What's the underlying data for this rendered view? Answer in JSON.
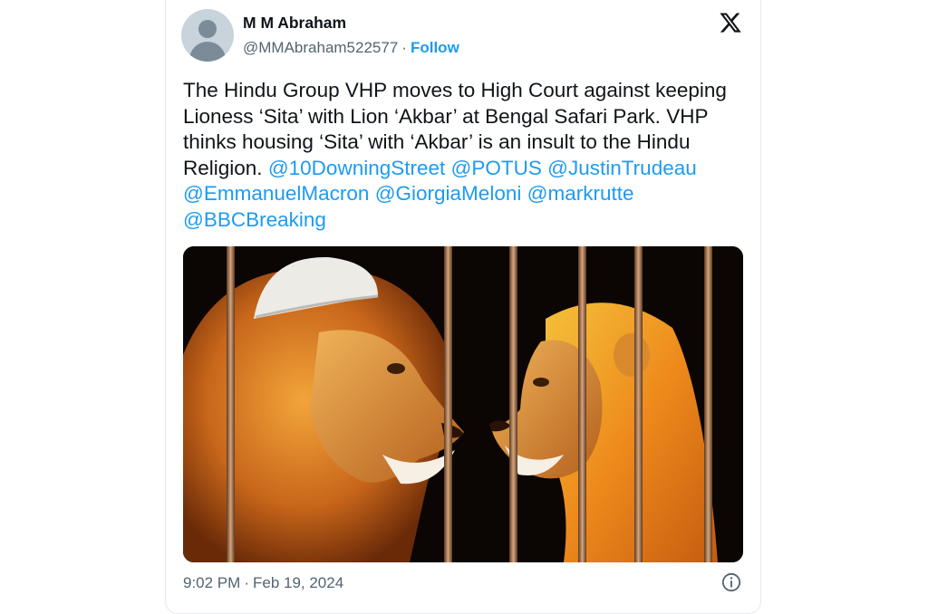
{
  "user": {
    "display_name": "M M Abraham",
    "handle": "@MMAbraham522577",
    "separator": "·",
    "follow_label": "Follow",
    "avatar_icon": "default-avatar-icon"
  },
  "header": {
    "logo_icon": "x-logo-icon"
  },
  "tweet": {
    "text_parts": {
      "body": "The Hindu Group VHP moves to High Court against keeping Lioness ‘Sita’ with Lion ‘Akbar’ at Bengal Safari Park. VHP thinks housing ‘Sita’ with ‘Akbar’ is an insult to the Hindu Religion. ",
      "mentions": [
        "@10DowningStreet",
        "@POTUS",
        "@JustinTrudeau",
        "@EmmanuelMacron",
        "@GiorgiaMeloni",
        "@markrutte",
        "@BBCBreaking"
      ]
    },
    "media_alt_icon": "lion-and-lioness-image"
  },
  "footer": {
    "time": "9:02 PM",
    "separator": "·",
    "date": "Feb 19, 2024",
    "info_icon": "info-icon"
  },
  "colors": {
    "accent": "#1d9bf0",
    "text": "#0f1419",
    "secondary": "#536471",
    "border": "#e6e9ec"
  }
}
